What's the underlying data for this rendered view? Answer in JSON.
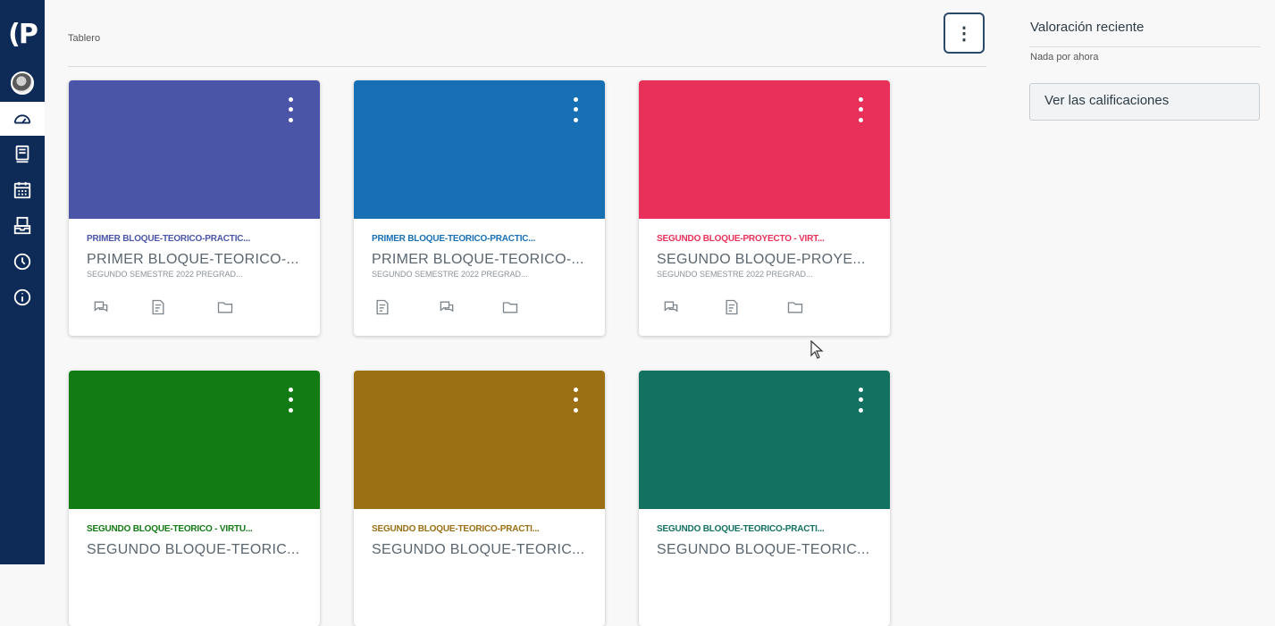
{
  "breadcrumb": "Tablero",
  "options_button_glyph": "⋮",
  "nav": {
    "logo_text": "(P",
    "items": [
      "avatar",
      "dashboard-icon",
      "courses-icon",
      "calendar-icon",
      "inbox-icon",
      "history-icon",
      "help-icon"
    ]
  },
  "cards": [
    {
      "color": "#4a55a8",
      "short_name": "PRIMER BLOQUE-TEORICO-PRACTIC...",
      "short_color": "#4a55a8",
      "long_name": "PRIMER BLOQUE-TEORICO-...",
      "term": "SEGUNDO SEMESTRE 2022 PREGRAD...",
      "icons": [
        "discussions-icon",
        "assignments-icon",
        "files-icon"
      ]
    },
    {
      "color": "#1870b4",
      "short_name": "PRIMER BLOQUE-TEORICO-PRACTIC...",
      "short_color": "#1870b4",
      "long_name": "PRIMER BLOQUE-TEORICO-...",
      "term": "SEGUNDO SEMESTRE 2022 PREGRAD...",
      "icons": [
        "assignments-icon",
        "discussions-icon",
        "files-icon"
      ]
    },
    {
      "color": "#e8305a",
      "short_name": "SEGUNDO BLOQUE-PROYECTO - VIRT...",
      "short_color": "#e8305a",
      "long_name": "SEGUNDO BLOQUE-PROYE...",
      "term": "SEGUNDO SEMESTRE 2022 PREGRAD...",
      "icons": [
        "discussions-icon",
        "assignments-icon",
        "files-icon"
      ]
    },
    {
      "color": "#137b14",
      "short_name": "SEGUNDO BLOQUE-TEORICO - VIRTU...",
      "short_color": "#137b14",
      "long_name": "SEGUNDO BLOQUE-TEORIC...",
      "term": "",
      "icons": []
    },
    {
      "color": "#9b6f14",
      "short_name": "SEGUNDO BLOQUE-TEORICO-PRACTI...",
      "short_color": "#9b6f14",
      "long_name": "SEGUNDO BLOQUE-TEORIC...",
      "term": "",
      "icons": []
    },
    {
      "color": "#137162",
      "short_name": "SEGUNDO BLOQUE-TEORICO-PRACTI...",
      "short_color": "#137162",
      "long_name": "SEGUNDO BLOQUE-TEORIC...",
      "term": "",
      "icons": []
    }
  ],
  "sidebar": {
    "title": "Valoración reciente",
    "empty_text": "Nada por ahora",
    "grades_button": "Ver las calificaciones"
  }
}
